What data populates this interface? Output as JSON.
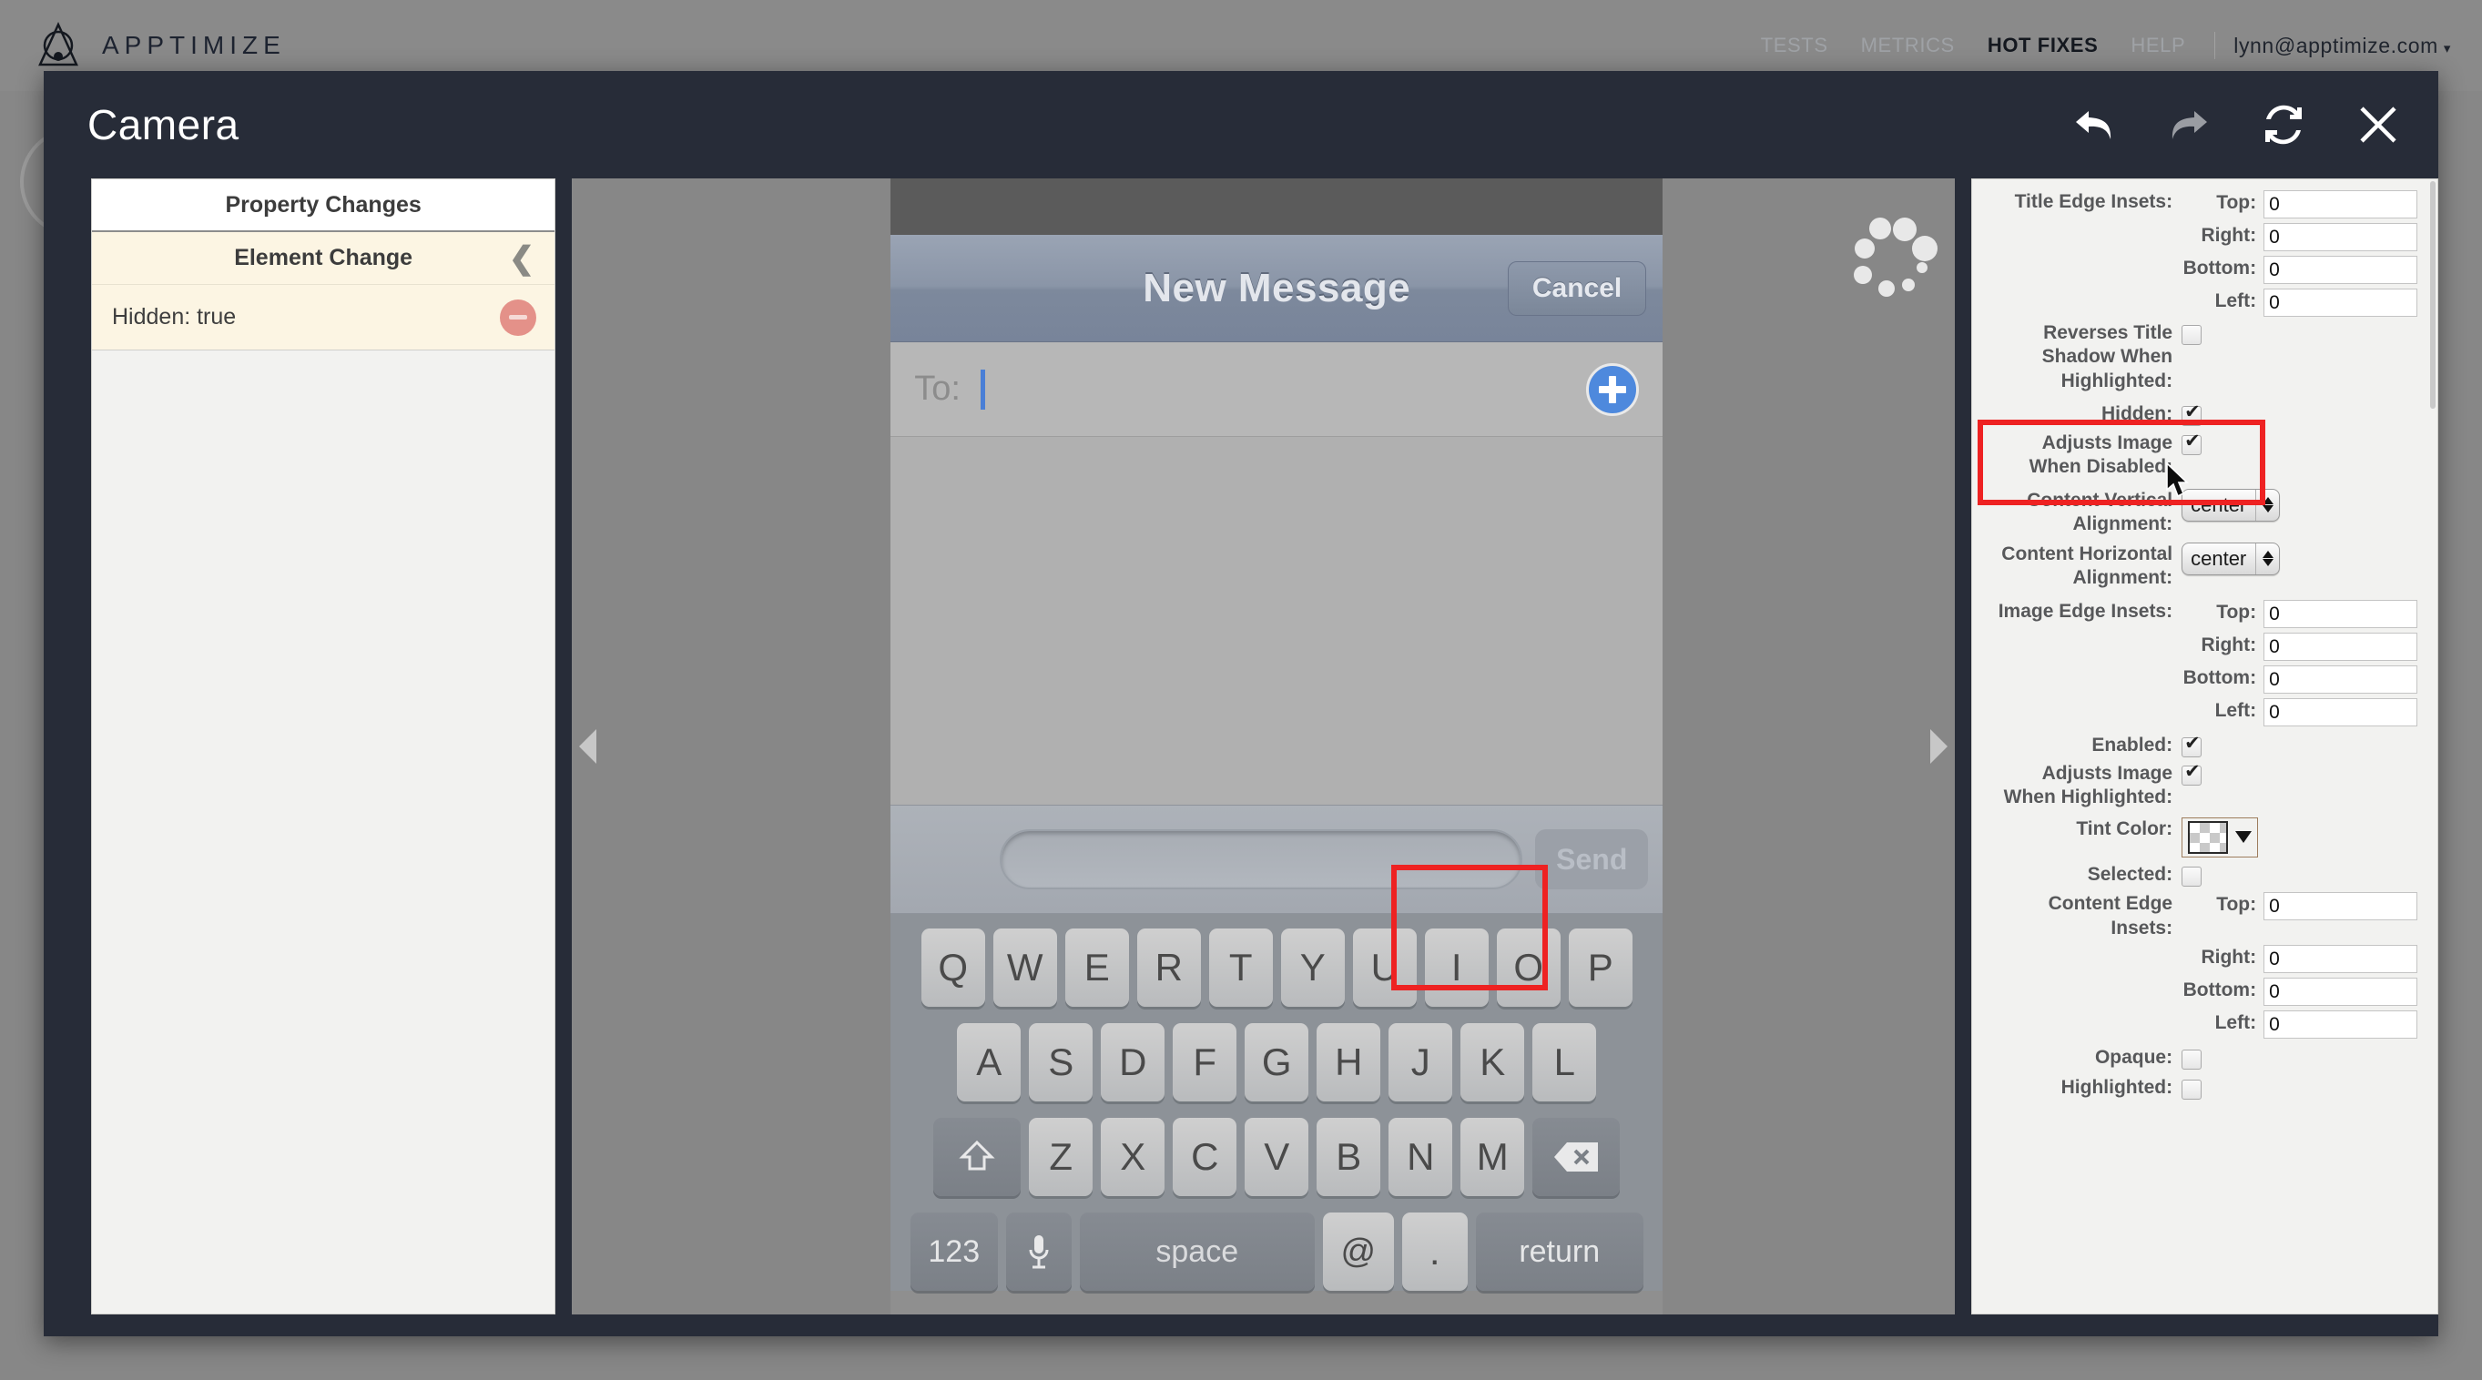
{
  "top_nav": {
    "brand": "APPTIMIZE",
    "logo_icon": "apptimize-logo-icon",
    "links": [
      {
        "label": "TESTS",
        "active": false
      },
      {
        "label": "METRICS",
        "active": false
      },
      {
        "label": "HOT FIXES",
        "active": true
      },
      {
        "label": "HELP",
        "active": false
      }
    ],
    "user": "lynn@apptimize.com",
    "user_caret": "▾"
  },
  "modal": {
    "title": "Camera",
    "actions": [
      {
        "name": "undo-button",
        "icon": "undo-arrow-icon",
        "state": "enabled"
      },
      {
        "name": "redo-button",
        "icon": "redo-arrow-icon",
        "state": "disabled"
      },
      {
        "name": "refresh-button",
        "icon": "refresh-icon",
        "state": "enabled"
      },
      {
        "name": "close-button",
        "icon": "close-x-icon",
        "state": "enabled"
      }
    ]
  },
  "left_panel": {
    "header": "Property Changes",
    "section": {
      "label": "Element Change",
      "collapse_icon": "chevron-left-icon"
    },
    "changes": [
      {
        "label": "Hidden: true",
        "remove_icon": "remove-circle-icon"
      }
    ]
  },
  "preview": {
    "spinner_icon": "loading-spinner-icon",
    "handle_left_icon": "chevron-left-triangle-icon",
    "handle_right_icon": "chevron-right-triangle-icon",
    "navbar_title": "New Message",
    "cancel_label": "Cancel",
    "to_label": "To:",
    "add_contact_icon": "add-contact-plus-icon",
    "send_label": "Send",
    "keyboard": {
      "row1": [
        "Q",
        "W",
        "E",
        "R",
        "T",
        "Y",
        "U",
        "I",
        "O",
        "P"
      ],
      "row2": [
        "A",
        "S",
        "D",
        "F",
        "G",
        "H",
        "J",
        "K",
        "L"
      ],
      "row3_shift_icon": "shift-arrow-icon",
      "row3": [
        "Z",
        "X",
        "C",
        "V",
        "B",
        "N",
        "M"
      ],
      "row3_delete_icon": "backspace-delete-icon",
      "row4_numbers": "123",
      "row4_mic_icon": "microphone-icon",
      "row4_space": "space",
      "row4_at": "@",
      "row4_period": ".",
      "row4_return": "return"
    }
  },
  "props": [
    {
      "type": "input",
      "label": "Title Edge Insets:",
      "sub": "Top:",
      "value": "0",
      "width": "w-lg"
    },
    {
      "type": "input",
      "label": "",
      "sub": "Right:",
      "value": "0",
      "width": "w-md"
    },
    {
      "type": "input",
      "label": "",
      "sub": "Bottom:",
      "value": "0",
      "width": "w-xl"
    },
    {
      "type": "input",
      "label": "",
      "sub": "Left:",
      "value": "0",
      "width": "w-lg"
    },
    {
      "type": "check",
      "label": "Reverses Title Shadow When Highlighted:",
      "checked": false
    },
    {
      "type": "check",
      "label": "Hidden:",
      "checked": true
    },
    {
      "type": "check",
      "label": "Adjusts Image When Disabled:",
      "checked": true
    },
    {
      "type": "select",
      "label": "Content Vertical Alignment:",
      "value": "center"
    },
    {
      "type": "select",
      "label": "Content Horizontal Alignment:",
      "value": "center"
    },
    {
      "type": "input",
      "label": "Image Edge Insets:",
      "sub": "Top:",
      "value": "0",
      "width": "w-lg"
    },
    {
      "type": "input",
      "label": "",
      "sub": "Right:",
      "value": "0",
      "width": "w-md"
    },
    {
      "type": "input",
      "label": "",
      "sub": "Bottom:",
      "value": "0",
      "width": "w-xl"
    },
    {
      "type": "input",
      "label": "",
      "sub": "Left:",
      "value": "0",
      "width": "w-lg"
    },
    {
      "type": "check",
      "label": "Enabled:",
      "checked": true
    },
    {
      "type": "check",
      "label": "Adjusts Image When Highlighted:",
      "checked": true
    },
    {
      "type": "color",
      "label": "Tint Color:",
      "value": "transparent",
      "border_color": "#9d7d5d"
    },
    {
      "type": "check",
      "label": "Selected:",
      "checked": false
    },
    {
      "type": "input",
      "label": "Content Edge Insets:",
      "sub": "Top:",
      "value": "0",
      "width": "w-lg"
    },
    {
      "type": "input",
      "label": "",
      "sub": "Right:",
      "value": "0",
      "width": "w-md"
    },
    {
      "type": "input",
      "label": "",
      "sub": "Bottom:",
      "value": "0",
      "width": "w-xl"
    },
    {
      "type": "input",
      "label": "",
      "sub": "Left:",
      "value": "0",
      "width": "w-lg"
    },
    {
      "type": "check",
      "label": "Opaque:",
      "checked": false
    },
    {
      "type": "check",
      "label": "Highlighted:",
      "checked": false
    }
  ],
  "annotations": {
    "highlight_color": "#ee2222",
    "boxes": [
      {
        "name": "preview-selection-box"
      },
      {
        "name": "hidden-property-highlight-box"
      }
    ]
  },
  "colors": {
    "modal_chrome": "#272c38",
    "panel_bg": "#f2f2f0",
    "change_row_bg": "#fcf5e3",
    "accent_red": "#ee2222",
    "app_bg": "#878787"
  }
}
